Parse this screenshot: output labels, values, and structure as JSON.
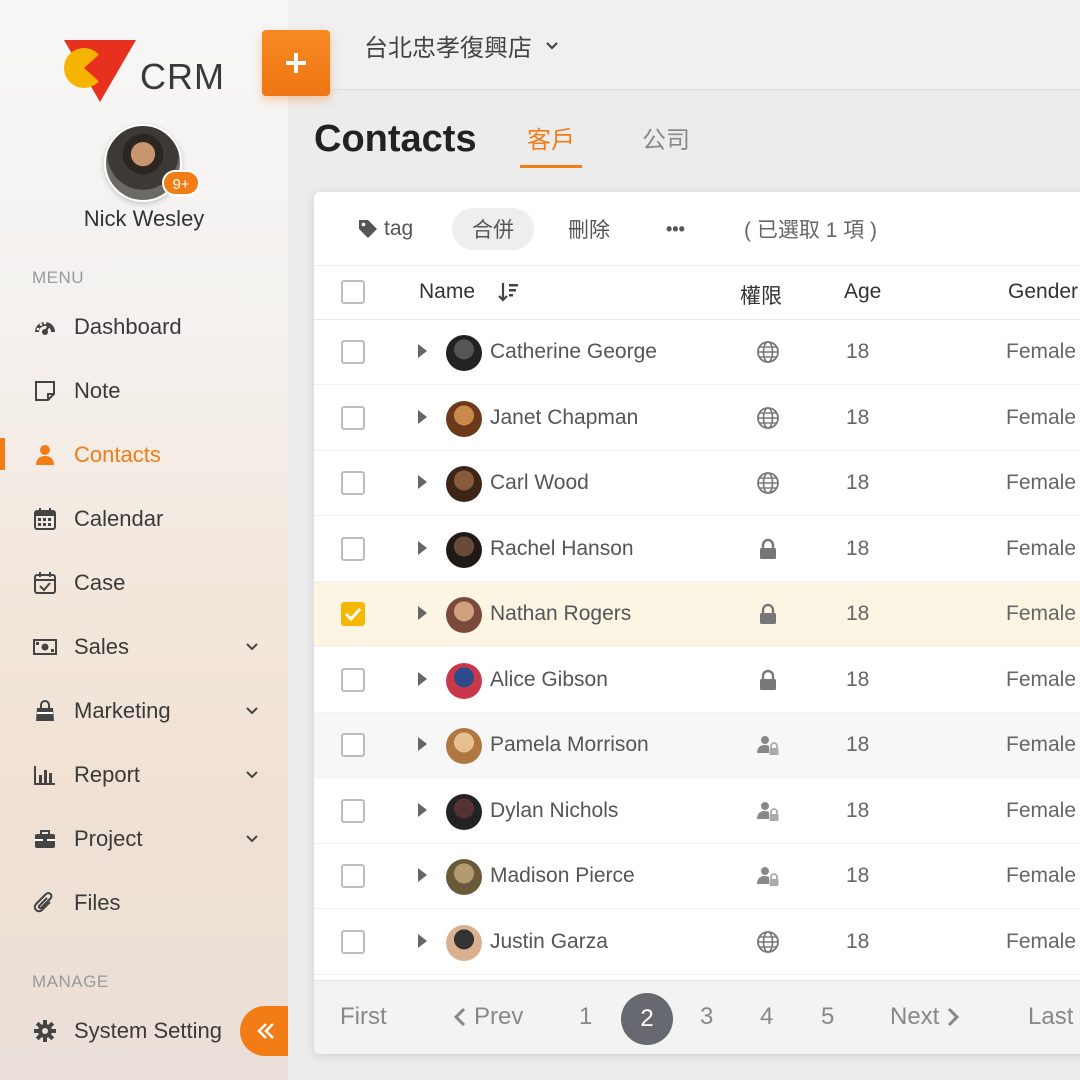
{
  "app": {
    "logo_text": "CRM",
    "accent": "#f27c16"
  },
  "user": {
    "name": "Nick Wesley",
    "notification_badge": "9+"
  },
  "sidebar": {
    "menu_label": "MENU",
    "manage_label": "MANAGE",
    "items": [
      {
        "label": "Dashboard",
        "icon": "dashboard-icon"
      },
      {
        "label": "Note",
        "icon": "note-icon"
      },
      {
        "label": "Contacts",
        "icon": "person-icon",
        "active": true
      },
      {
        "label": "Calendar",
        "icon": "calendar-icon"
      },
      {
        "label": "Case",
        "icon": "calendar-check-icon"
      },
      {
        "label": "Sales",
        "icon": "money-icon",
        "expandable": true
      },
      {
        "label": "Marketing",
        "icon": "shopping-bag-icon",
        "expandable": true
      },
      {
        "label": "Report",
        "icon": "bar-chart-icon",
        "expandable": true
      },
      {
        "label": "Project",
        "icon": "briefcase-icon",
        "expandable": true
      },
      {
        "label": "Files",
        "icon": "paperclip-icon"
      }
    ],
    "manage_items": [
      {
        "label": "System Setting",
        "icon": "gear-icon"
      }
    ]
  },
  "topbar": {
    "store": "台北忠孝復興店"
  },
  "page": {
    "title": "Contacts",
    "tabs": [
      {
        "label": "客戶",
        "active": true
      },
      {
        "label": "公司",
        "active": false
      }
    ]
  },
  "toolbar": {
    "tag_label": "tag",
    "merge_label": "合併",
    "delete_label": "刪除",
    "more_label": "•••",
    "selection_status": "( 已選取 1 項 )"
  },
  "table": {
    "columns": {
      "name": "Name",
      "permission": "權限",
      "age": "Age",
      "gender": "Gender"
    },
    "rows": [
      {
        "name": "Catherine George",
        "permission": "globe-icon",
        "age": "18",
        "gender": "Female",
        "selected": false
      },
      {
        "name": "Janet Chapman",
        "permission": "globe-icon",
        "age": "18",
        "gender": "Female",
        "selected": false
      },
      {
        "name": "Carl Wood",
        "permission": "globe-icon",
        "age": "18",
        "gender": "Female",
        "selected": false
      },
      {
        "name": "Rachel Hanson",
        "permission": "lock-icon",
        "age": "18",
        "gender": "Female",
        "selected": false
      },
      {
        "name": "Nathan Rogers",
        "permission": "lock-icon",
        "age": "18",
        "gender": "Female",
        "selected": true
      },
      {
        "name": "Alice Gibson",
        "permission": "lock-icon",
        "age": "18",
        "gender": "Female",
        "selected": false
      },
      {
        "name": "Pamela Morrison",
        "permission": "user-lock-icon",
        "age": "18",
        "gender": "Female",
        "selected": false
      },
      {
        "name": "Dylan Nichols",
        "permission": "user-lock-icon",
        "age": "18",
        "gender": "Female",
        "selected": false
      },
      {
        "name": "Madison Pierce",
        "permission": "user-lock-icon",
        "age": "18",
        "gender": "Female",
        "selected": false
      },
      {
        "name": "Justin Garza",
        "permission": "globe-icon",
        "age": "18",
        "gender": "Female",
        "selected": false
      }
    ]
  },
  "pagination": {
    "first": "First",
    "prev": "Prev",
    "pages": [
      "1",
      "2",
      "3",
      "4",
      "5"
    ],
    "current": "2",
    "next": "Next",
    "last": "Last"
  }
}
